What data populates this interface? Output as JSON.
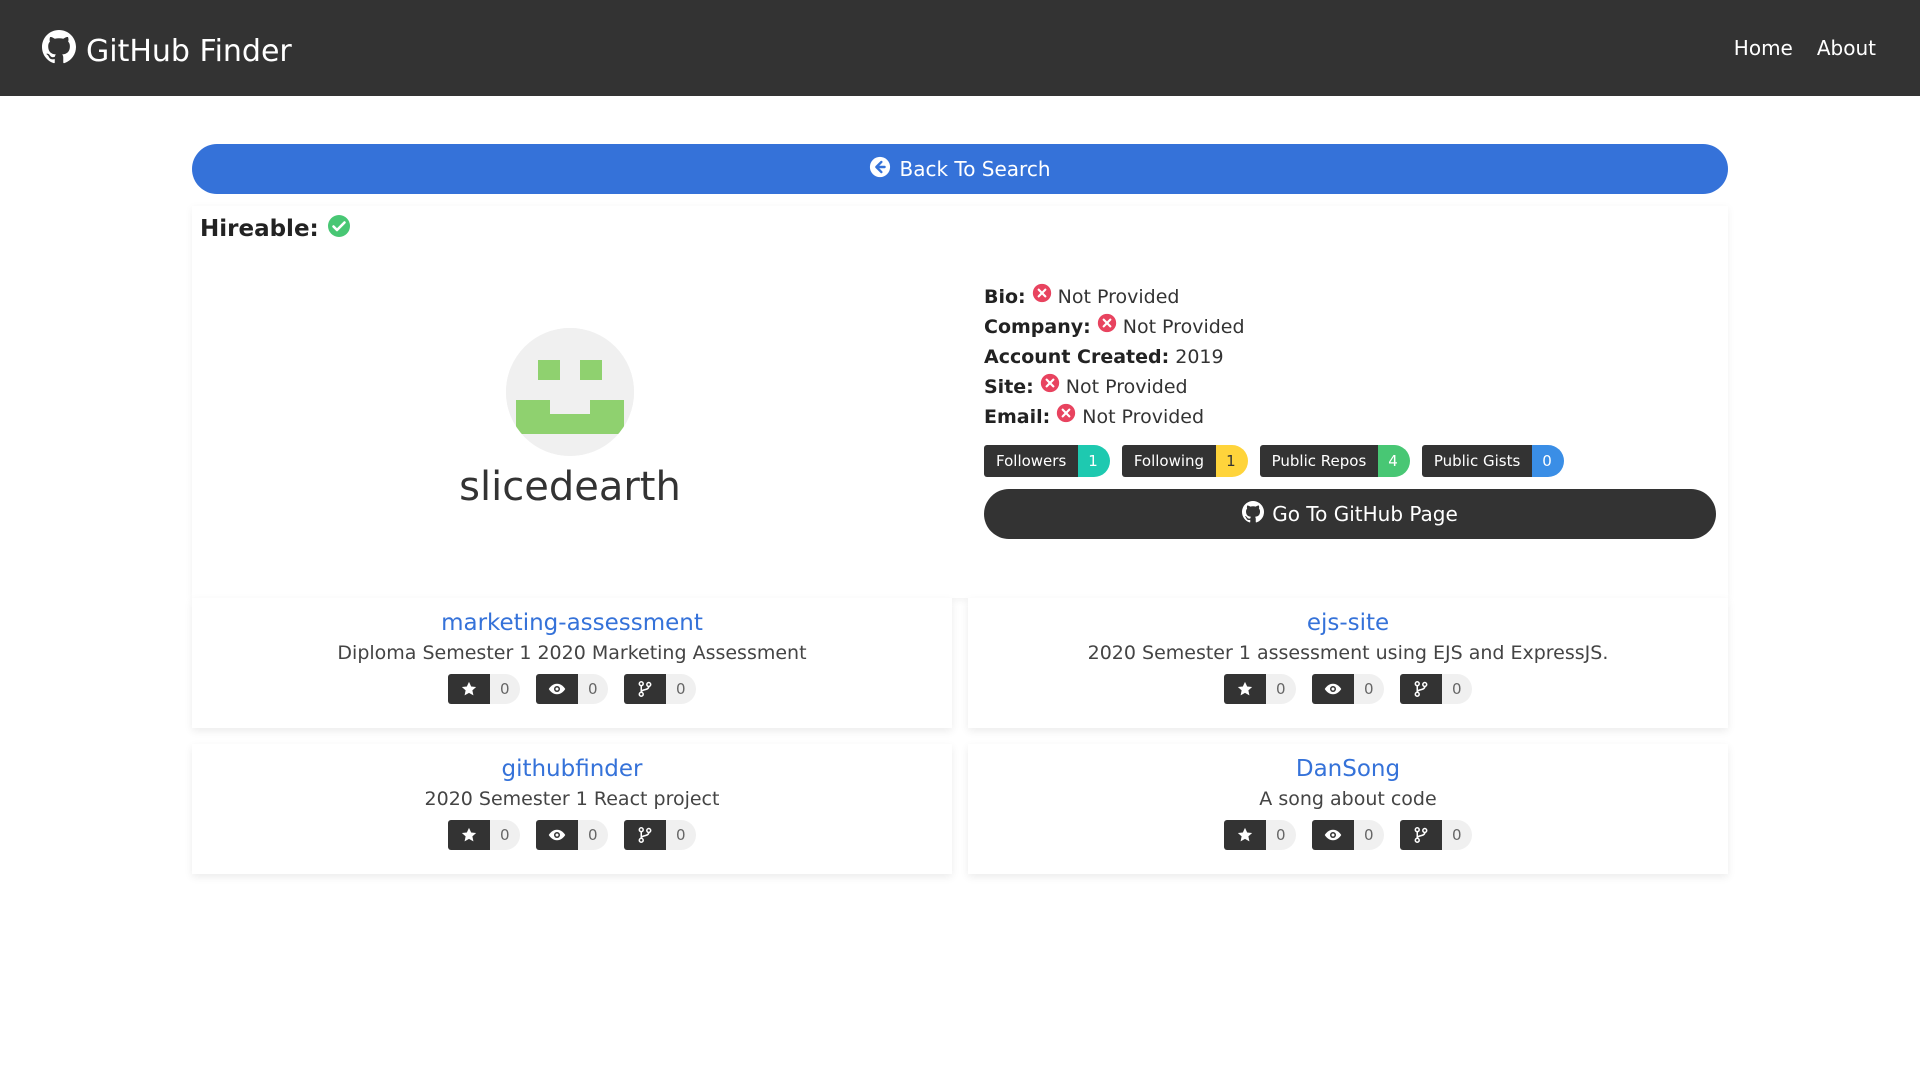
{
  "navbar": {
    "brand": "GitHub Finder",
    "links": [
      "Home",
      "About"
    ]
  },
  "back_button": {
    "label": "Back To Search"
  },
  "profile": {
    "hireable_label": "Hireable:",
    "hireable": true,
    "username": "slicedearth",
    "fields": [
      {
        "label": "Bio:",
        "value": "Not Provided",
        "missing": true
      },
      {
        "label": "Company:",
        "value": "Not Provided",
        "missing": true
      },
      {
        "label": "Account Created:",
        "value": "2019",
        "missing": false
      },
      {
        "label": "Site:",
        "value": "Not Provided",
        "missing": true
      },
      {
        "label": "Email:",
        "value": "Not Provided",
        "missing": true
      }
    ],
    "badges": [
      {
        "label": "Followers",
        "count": "1",
        "color": "#1ec9b0"
      },
      {
        "label": "Following",
        "count": "1",
        "color": "#ffd43b"
      },
      {
        "label": "Public Repos",
        "count": "4",
        "color": "#48c774"
      },
      {
        "label": "Public Gists",
        "count": "0",
        "color": "#3a8ee6"
      }
    ],
    "github_button": "Go To GitHub Page"
  },
  "repos": [
    {
      "name": "marketing-assessment",
      "description": "Diploma Semester 1 2020 Marketing Assessment",
      "stars": "0",
      "watchers": "0",
      "forks": "0"
    },
    {
      "name": "ejs-site",
      "description": "2020 Semester 1 assessment using EJS and ExpressJS.",
      "stars": "0",
      "watchers": "0",
      "forks": "0"
    },
    {
      "name": "githubfinder",
      "description": "2020 Semester 1 React project",
      "stars": "0",
      "watchers": "0",
      "forks": "0"
    },
    {
      "name": "DanSong",
      "description": "A song about code",
      "stars": "0",
      "watchers": "0",
      "forks": "0"
    }
  ],
  "colors": {
    "navbar": "#333333",
    "primary": "#3572d9",
    "dark": "#333333",
    "success": "#48c774",
    "danger": "#e8435f",
    "avatar_green": "#8fd16f"
  },
  "icons": {
    "brand": "github-icon",
    "back": "arrow-circle-left-icon",
    "hireable": "check-circle-icon",
    "missing": "times-circle-icon",
    "star": "star-icon",
    "watch": "eye-icon",
    "fork": "code-branch-icon"
  }
}
